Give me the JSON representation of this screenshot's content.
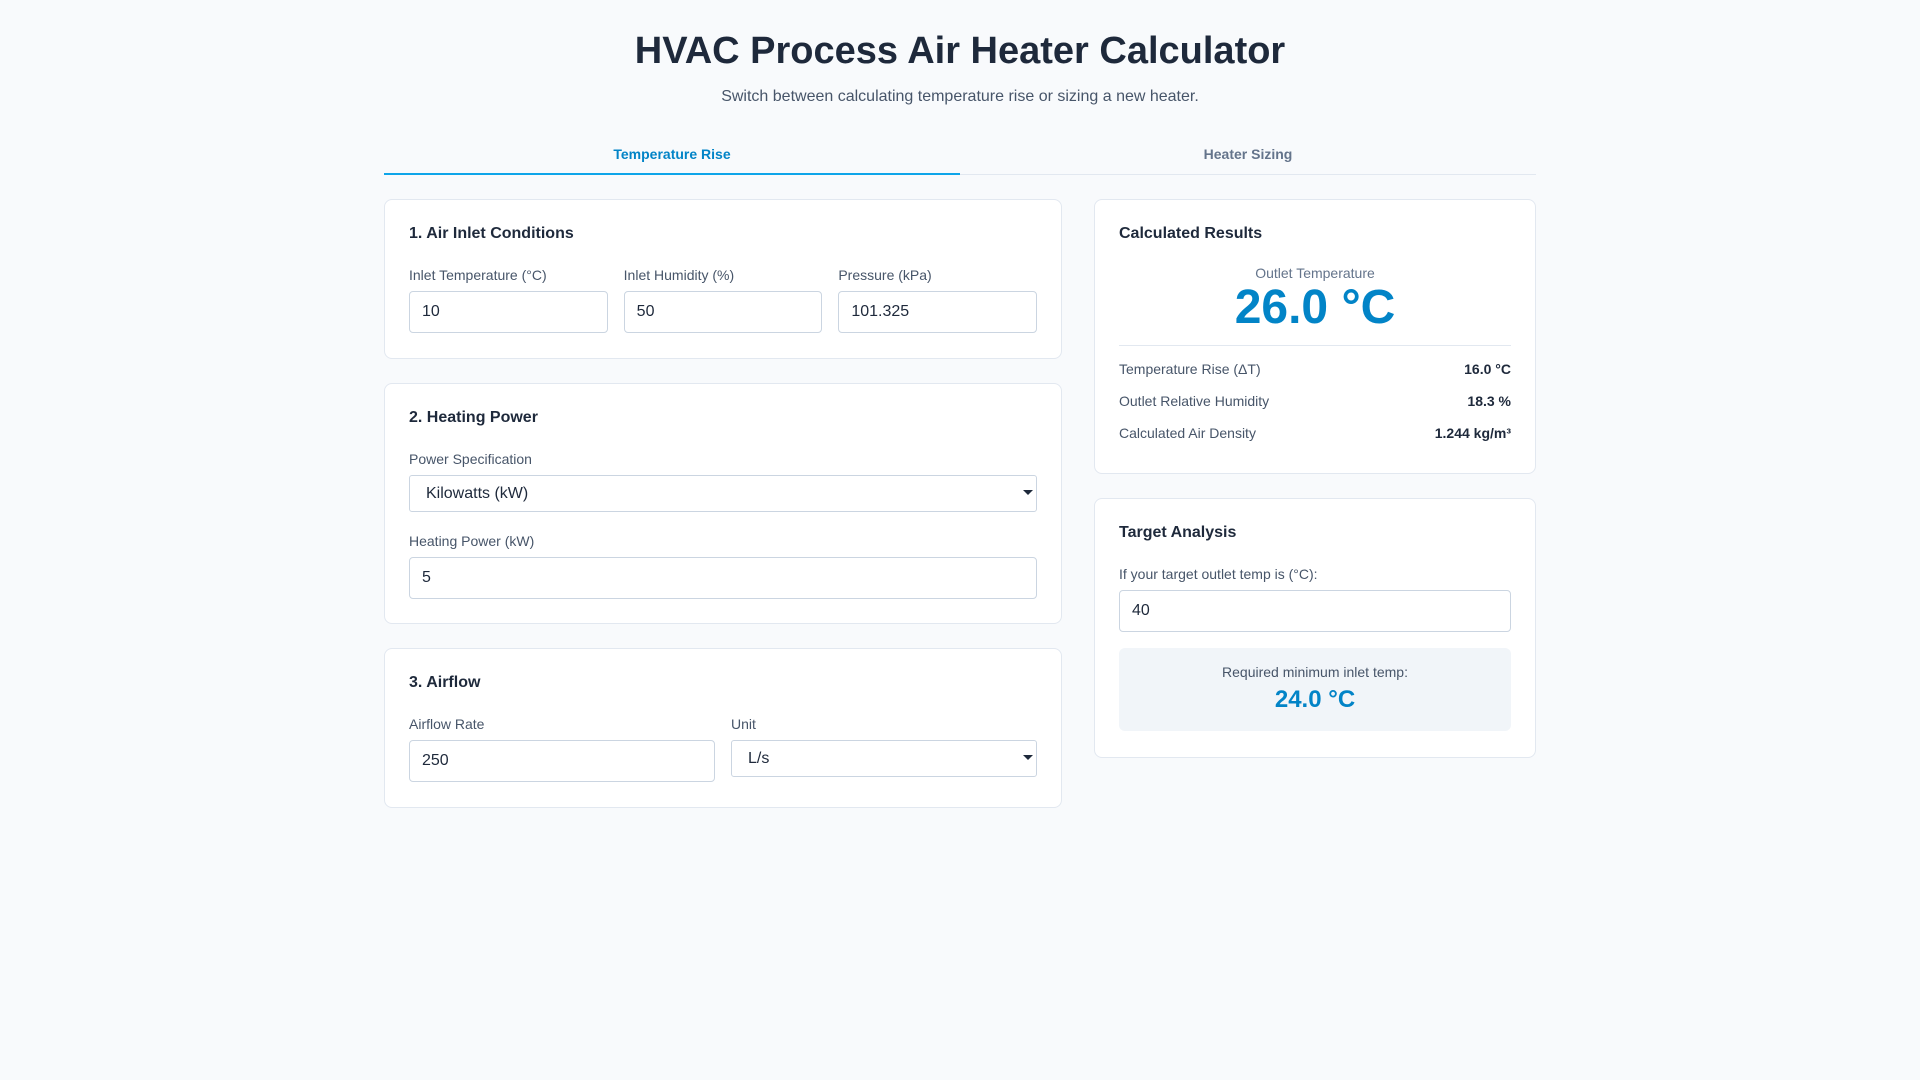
{
  "header": {
    "title": "HVAC Process Air Heater Calculator",
    "subtitle": "Switch between calculating temperature rise or sizing a new heater."
  },
  "tabs": [
    {
      "label": "Temperature Rise",
      "active": true
    },
    {
      "label": "Heater Sizing",
      "active": false
    }
  ],
  "inlet": {
    "title": "1. Air Inlet Conditions",
    "temperature": {
      "label": "Inlet Temperature (°C)",
      "value": "10"
    },
    "humidity": {
      "label": "Inlet Humidity (%)",
      "value": "50"
    },
    "pressure": {
      "label": "Pressure (kPa)",
      "value": "101.325"
    }
  },
  "power": {
    "title": "2. Heating Power",
    "spec_label": "Power Specification",
    "spec_value": "Kilowatts (kW)",
    "heating_label": "Heating Power (kW)",
    "heating_value": "5"
  },
  "airflow": {
    "title": "3. Airflow",
    "rate_label": "Airflow Rate",
    "rate_value": "250",
    "unit_label": "Unit",
    "unit_value": "L/s"
  },
  "results": {
    "title": "Calculated Results",
    "outlet_label": "Outlet Temperature",
    "outlet_value": "26.0 °C",
    "metrics": [
      {
        "label": "Temperature Rise (ΔT)",
        "value": "16.0 °C"
      },
      {
        "label": "Outlet Relative Humidity",
        "value": "18.3 %"
      },
      {
        "label": "Calculated Air Density",
        "value": "1.244 kg/m³"
      }
    ]
  },
  "target": {
    "title": "Target Analysis",
    "input_label": "If your target outlet temp is (°C):",
    "input_value": "40",
    "required_label": "Required minimum inlet temp:",
    "required_value": "24.0 °C"
  },
  "colors": {
    "accent": "#0284c7",
    "background": "#f8fafc",
    "card": "#ffffff",
    "border": "#e2e8f0"
  }
}
